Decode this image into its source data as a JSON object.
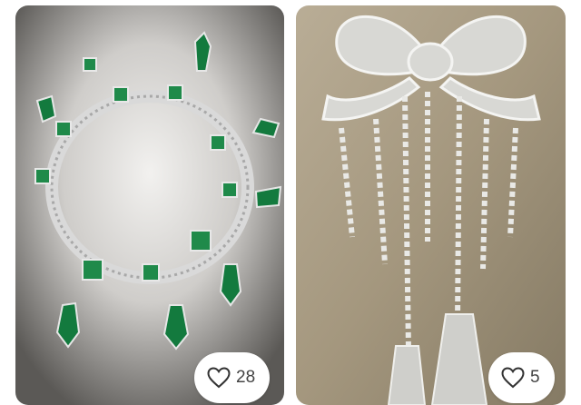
{
  "posts": [
    {
      "image": "emerald-necklace-photo",
      "likes_icon": "heart-outline-icon",
      "likes": "28"
    },
    {
      "image": "diamond-bow-brooch-photo",
      "likes_icon": "heart-outline-icon",
      "likes": "5"
    }
  ],
  "colors": {
    "card_bg_left": "#3a3936",
    "card_bg_right": "#9a8e78",
    "emerald": "#1f8a4a",
    "pill_bg": "#ffffff"
  }
}
